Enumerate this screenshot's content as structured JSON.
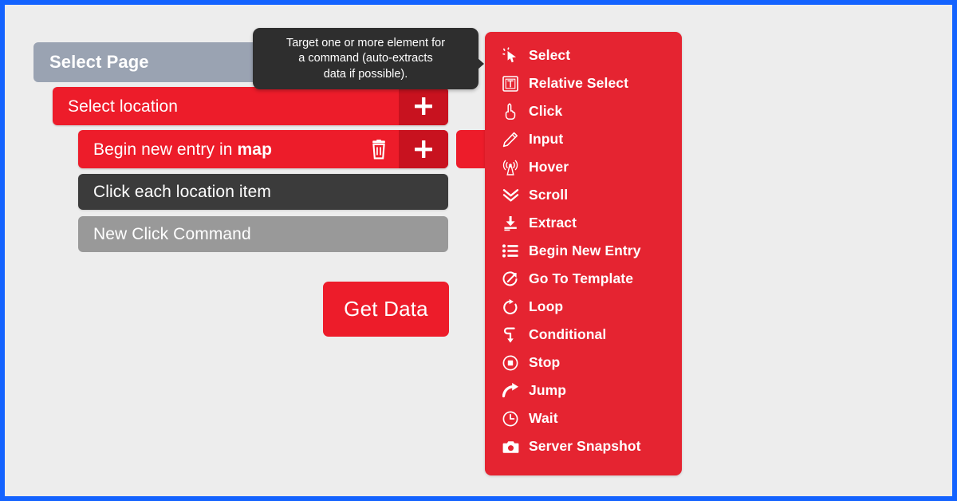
{
  "colors": {
    "page_border": "#1463ff",
    "canvas": "#ededed",
    "brand_red": "#ed1c2a",
    "menu_red": "#e52431",
    "plus_red": "#c8121f",
    "dark_bar": "#3b3b3b",
    "gray_bar": "#999999",
    "blue_gray_bar": "#9aa3b2",
    "tooltip_bg": "#2e2e2e"
  },
  "tooltip": {
    "line1": "Target one or more element for",
    "line2": "a command (auto-extracts",
    "line3": "data if possible)."
  },
  "workflow": [
    {
      "id": "select-page",
      "label": "Select Page",
      "style": "blue-gray",
      "bold": true,
      "has_plus": false,
      "has_trash": false
    },
    {
      "id": "select-location",
      "label": "Select location",
      "style": "red",
      "bold": false,
      "has_plus": true,
      "has_trash": false
    },
    {
      "id": "begin-new-entry",
      "label": "Begin new entry in ",
      "label_strong": "map",
      "style": "red",
      "bold": false,
      "has_plus": true,
      "has_trash": true
    },
    {
      "id": "click-each-item",
      "label": "Click each location item",
      "style": "dark",
      "bold": false,
      "has_plus": false,
      "has_trash": false
    },
    {
      "id": "new-click-command",
      "label": "New Click Command",
      "style": "gray",
      "bold": false,
      "has_plus": false,
      "has_trash": false
    }
  ],
  "get_data_button": {
    "label": "Get Data"
  },
  "command_menu": {
    "items": [
      {
        "label": "Select",
        "icon": "cursor-sparkle-icon"
      },
      {
        "label": "Relative Select",
        "icon": "frame-select-icon"
      },
      {
        "label": "Click",
        "icon": "pointing-hand-icon"
      },
      {
        "label": "Input",
        "icon": "pencil-icon"
      },
      {
        "label": "Hover",
        "icon": "broadcast-tower-icon"
      },
      {
        "label": "Scroll",
        "icon": "double-chevron-down-icon"
      },
      {
        "label": "Extract",
        "icon": "download-tray-icon"
      },
      {
        "label": "Begin New Entry",
        "icon": "list-icon"
      },
      {
        "label": "Go To Template",
        "icon": "arrow-circle-out-icon"
      },
      {
        "label": "Loop",
        "icon": "refresh-loop-icon"
      },
      {
        "label": "Conditional",
        "icon": "branch-arrow-icon"
      },
      {
        "label": "Stop",
        "icon": "stop-circle-icon"
      },
      {
        "label": "Jump",
        "icon": "arrow-curve-right-icon"
      },
      {
        "label": "Wait",
        "icon": "clock-icon"
      },
      {
        "label": "Server Snapshot",
        "icon": "camera-icon"
      }
    ]
  },
  "icons": {
    "plus": "plus-icon",
    "trash": "trash-icon"
  }
}
